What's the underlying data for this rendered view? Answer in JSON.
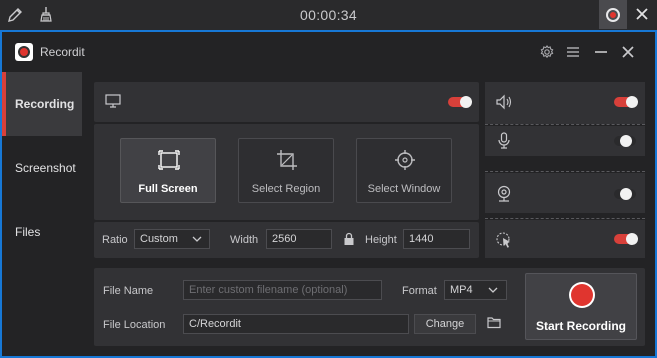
{
  "topbar": {
    "timer": "00:00:34",
    "icons": [
      "pencil-icon",
      "broom-icon",
      "stop-record-icon",
      "close-icon"
    ]
  },
  "window": {
    "title": "Recordit",
    "icons": [
      "settings-icon",
      "menu-icon",
      "minimize-icon",
      "close-icon"
    ]
  },
  "sidebar": {
    "items": [
      {
        "label": "Recording",
        "active": true
      },
      {
        "label": "Screenshot",
        "active": false
      },
      {
        "label": "Files",
        "active": false
      }
    ]
  },
  "display": {
    "icon": "monitor-icon",
    "enabled": true
  },
  "modes": [
    {
      "label": "Full Screen",
      "icon": "fullscreen-icon",
      "active": true
    },
    {
      "label": "Select Region",
      "icon": "crop-icon",
      "active": false
    },
    {
      "label": "Select Window",
      "icon": "crosshair-icon",
      "active": false
    }
  ],
  "dimensions": {
    "ratio_label": "Ratio",
    "ratio_value": "Custom",
    "width_label": "Width",
    "width_value": "2560",
    "height_label": "Height",
    "height_value": "1440",
    "lock_icon": "lock-icon"
  },
  "sources": [
    {
      "icon": "speaker-icon",
      "enabled": true
    },
    {
      "icon": "microphone-icon",
      "enabled": false
    },
    {
      "icon": "webcam-icon",
      "enabled": false
    },
    {
      "icon": "cursor-click-icon",
      "enabled": true
    }
  ],
  "file": {
    "name_label": "File Name",
    "name_placeholder": "Enter custom filename (optional)",
    "format_label": "Format",
    "format_value": "MP4",
    "location_label": "File Location",
    "location_value": "C/Recordit",
    "change_label": "Change",
    "folder_icon": "folder-icon"
  },
  "start_button": {
    "label": "Start Recording"
  },
  "colors": {
    "accent": "#d8403a",
    "border": "#1778d6",
    "background": "#232325",
    "panel": "#323235"
  }
}
